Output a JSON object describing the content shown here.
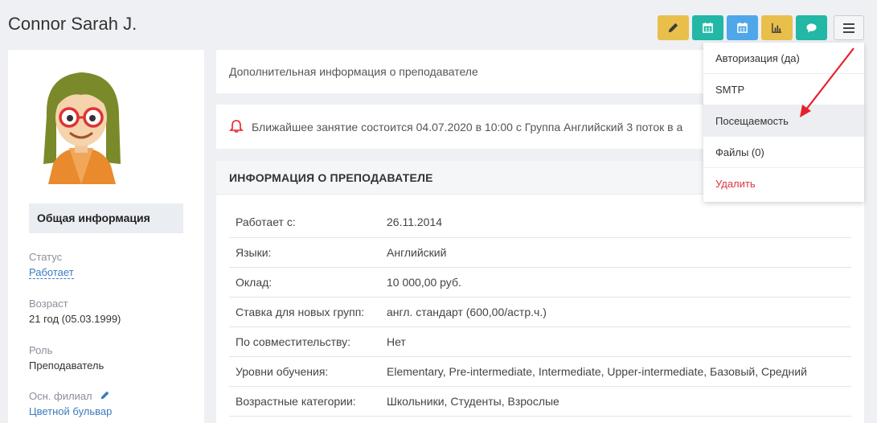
{
  "header": {
    "title": "Connor Sarah J.",
    "toolbar": [
      {
        "name": "edit-button",
        "icon": "pencil-icon",
        "color": "#e8bf4a"
      },
      {
        "name": "calendar-button",
        "icon": "calendar-icon",
        "color": "#22b8a5"
      },
      {
        "name": "schedule-button",
        "icon": "calendar-icon",
        "color": "#4fa7ea"
      },
      {
        "name": "stats-button",
        "icon": "bar-chart-icon",
        "color": "#e8bf4a"
      },
      {
        "name": "message-button",
        "icon": "chat-icon",
        "color": "#22b8a5"
      }
    ],
    "menu_icon": "hamburger-icon"
  },
  "sidebar": {
    "section_title": "Общая информация",
    "status": {
      "label": "Статус",
      "value": "Работает"
    },
    "age": {
      "label": "Возраст",
      "value": "21 год (05.03.1999)"
    },
    "role": {
      "label": "Роль",
      "value": "Преподаватель"
    },
    "branch": {
      "label": "Осн. филиал",
      "value": "Цветной бульвар"
    }
  },
  "info_link": "Дополнительная информация о преподавателе",
  "notice": "Ближайшее занятие состоится 04.07.2020 в 10:00 с Группа Английский 3 поток в а",
  "teacher": {
    "header": "ИНФОРМАЦИЯ О ПРЕПОДАВАТЕЛЕ",
    "rows": [
      {
        "key": "Работает с:",
        "value": "26.11.2014"
      },
      {
        "key": "Языки:",
        "value": "Английский"
      },
      {
        "key": "Оклад:",
        "value": "10 000,00 руб."
      },
      {
        "key": "Ставка для новых групп:",
        "value": "англ. стандарт (600,00/астр.ч.)"
      },
      {
        "key": "По совместительству:",
        "value": "Нет"
      },
      {
        "key": "Уровни обучения:",
        "value": "Elementary, Pre-intermediate, Intermediate, Upper-intermediate, Базовый, Средний"
      },
      {
        "key": "Возрастные категории:",
        "value": "Школьники, Студенты, Взрослые"
      }
    ]
  },
  "dropdown": {
    "items": [
      {
        "label": "Авторизация (да)"
      },
      {
        "label": "SMTP"
      },
      {
        "label": "Посещаемость"
      },
      {
        "label": "Файлы (0)"
      },
      {
        "label": "Удалить"
      }
    ]
  },
  "colors": {
    "accent_red": "#e5202a",
    "link": "#3b7bbf",
    "danger": "#d9363e"
  }
}
